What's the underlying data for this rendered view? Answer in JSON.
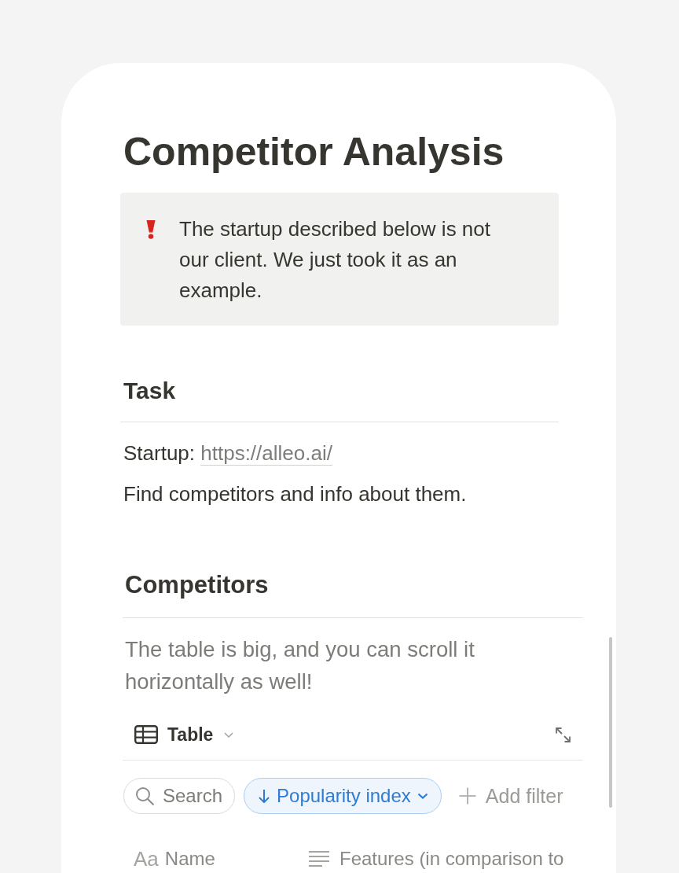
{
  "page": {
    "title": "Competitor Analysis"
  },
  "callout": {
    "text": "The startup described below is not our client. We just took it as an example."
  },
  "task": {
    "heading": "Task",
    "blocks": [
      {
        "kind": "link_line",
        "label": "Startup:",
        "link": "https://alleo.ai/"
      },
      {
        "kind": "paragraph",
        "text": "Find competitors and info about them."
      }
    ]
  },
  "competitors": {
    "heading": "Competitors",
    "note": "The table is big, and you can scroll it horizontally as well!",
    "view": {
      "label": "Table"
    },
    "filters": [
      {
        "kind": "search",
        "label": "Search"
      },
      {
        "kind": "sort",
        "label": "Popularity index"
      },
      {
        "kind": "add",
        "label": "Add filter"
      }
    ],
    "columns": [
      {
        "kind": "title",
        "glyph": "Aa",
        "label": "Name"
      },
      {
        "kind": "text",
        "label": "Features (in comparison to"
      }
    ]
  }
}
